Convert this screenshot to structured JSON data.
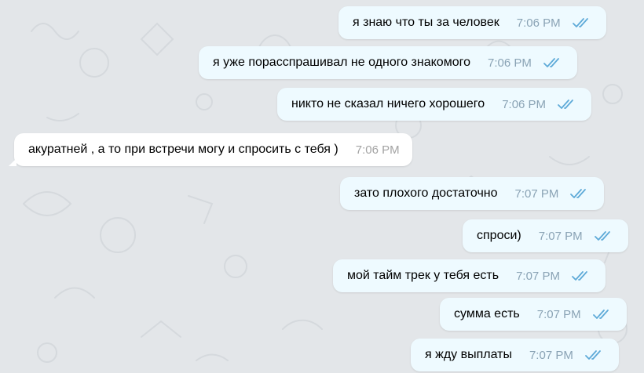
{
  "messages": [
    {
      "text": "я знаю что ты за человек",
      "time": "7:06 PM",
      "direction": "out",
      "status": "read-double-check"
    },
    {
      "text": "я уже порасспрашивал не одного знакомого",
      "time": "7:06 PM",
      "direction": "out",
      "status": "read-double-check"
    },
    {
      "text": "никто не сказал ничего хорошего",
      "time": "7:06 PM",
      "direction": "out",
      "status": "read-double-check"
    },
    {
      "text": "акуратней , а то при встречи могу и спросить с тебя )",
      "time": "7:06 PM",
      "direction": "in"
    },
    {
      "text": "зато плохого достаточно",
      "time": "7:07 PM",
      "direction": "out",
      "status": "read-double-check"
    },
    {
      "text": "спроси)",
      "time": "7:07 PM",
      "direction": "out",
      "status": "read-double-check"
    },
    {
      "text": "мой тайм трек у тебя есть",
      "time": "7:07 PM",
      "direction": "out",
      "status": "read-double-check"
    },
    {
      "text": "сумма есть",
      "time": "7:07 PM",
      "direction": "out",
      "status": "read-double-check"
    },
    {
      "text": "я жду выплаты",
      "time": "7:07 PM",
      "direction": "out",
      "status": "read-double-check"
    }
  ],
  "colors": {
    "background": "#e3e6e9",
    "outgoing_bubble": "#eefaff",
    "incoming_bubble": "#ffffff",
    "check": "#5eaad8",
    "time_out": "#8aa3b5"
  }
}
